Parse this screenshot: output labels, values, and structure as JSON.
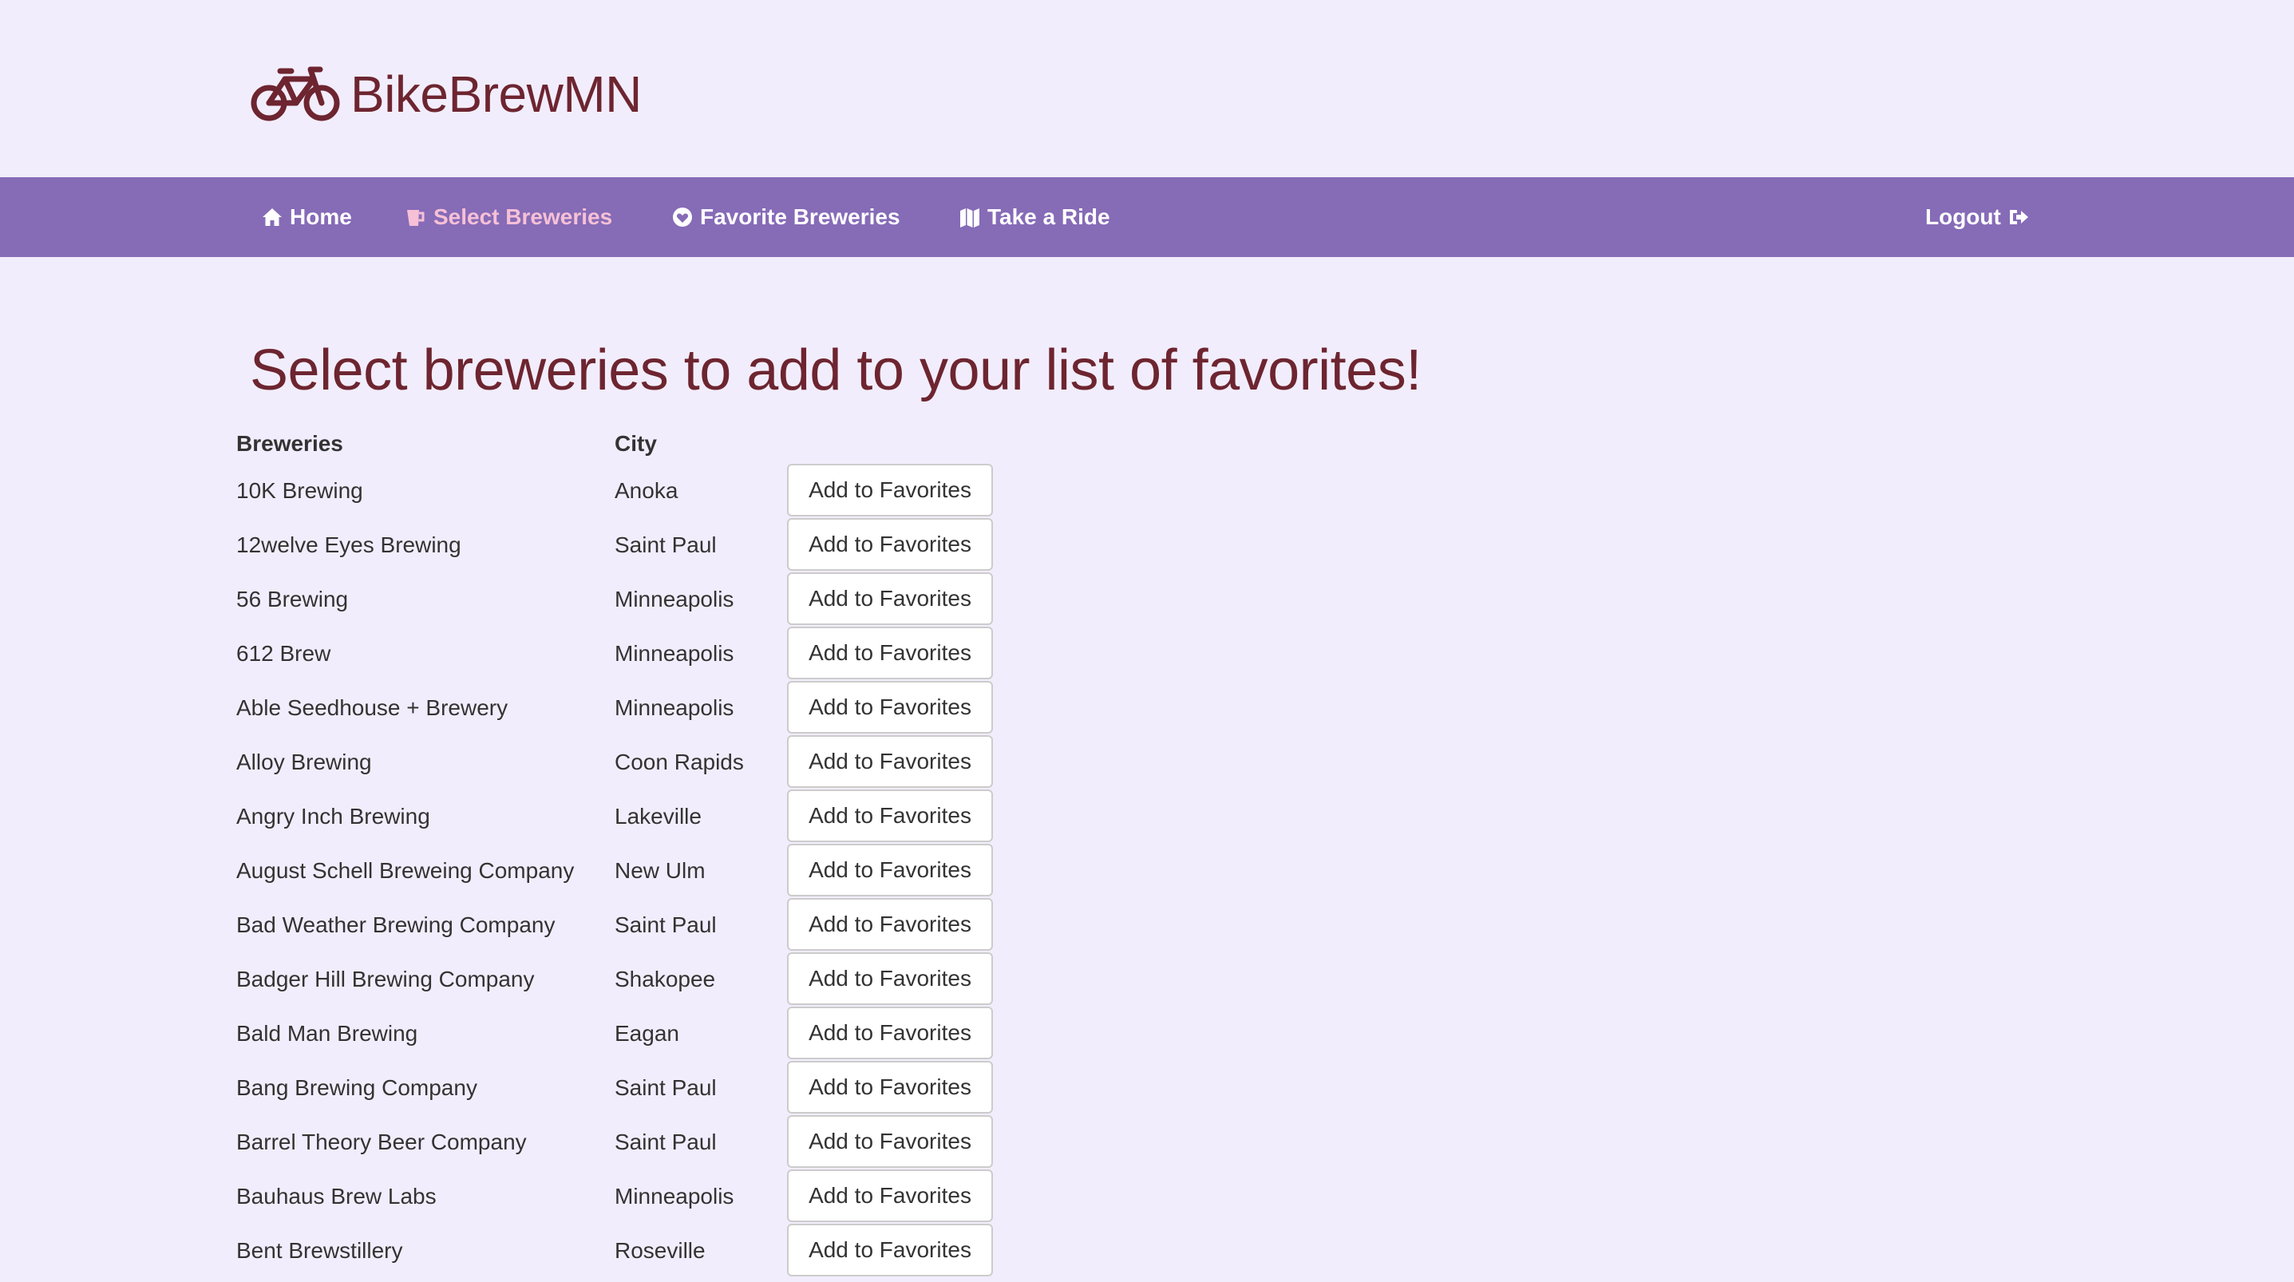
{
  "brand": {
    "name": "BikeBrewMN",
    "logo_icon": "bicycle-icon",
    "color": "#6d2530"
  },
  "nav": {
    "background": "#866bb7",
    "items": [
      {
        "label": "Home",
        "icon": "home-icon"
      },
      {
        "label": "Select Breweries",
        "icon": "beer-icon",
        "active": true
      },
      {
        "label": "Favorite Breweries",
        "icon": "heart-icon"
      },
      {
        "label": "Take a Ride",
        "icon": "map-icon"
      }
    ],
    "logout": {
      "label": "Logout",
      "icon": "sign-out-icon"
    }
  },
  "page": {
    "title": "Select breweries to add to your list of favorites!"
  },
  "table": {
    "headers": {
      "name": "Breweries",
      "city": "City"
    },
    "button_label": "Add to Favorites",
    "rows": [
      {
        "name": "10K Brewing",
        "city": "Anoka"
      },
      {
        "name": "12welve Eyes Brewing",
        "city": "Saint Paul"
      },
      {
        "name": "56 Brewing",
        "city": "Minneapolis"
      },
      {
        "name": "612 Brew",
        "city": "Minneapolis"
      },
      {
        "name": "Able Seedhouse + Brewery",
        "city": "Minneapolis"
      },
      {
        "name": "Alloy Brewing",
        "city": "Coon Rapids"
      },
      {
        "name": "Angry Inch Brewing",
        "city": "Lakeville"
      },
      {
        "name": "August Schell Breweing Company",
        "city": "New Ulm"
      },
      {
        "name": "Bad Weather Brewing Company",
        "city": "Saint Paul"
      },
      {
        "name": "Badger Hill Brewing Company",
        "city": "Shakopee"
      },
      {
        "name": "Bald Man Brewing",
        "city": "Eagan"
      },
      {
        "name": "Bang Brewing Company",
        "city": "Saint Paul"
      },
      {
        "name": "Barrel Theory Beer Company",
        "city": "Saint Paul"
      },
      {
        "name": "Bauhaus Brew Labs",
        "city": "Minneapolis"
      },
      {
        "name": "Bent Brewstillery",
        "city": "Roseville"
      }
    ]
  }
}
